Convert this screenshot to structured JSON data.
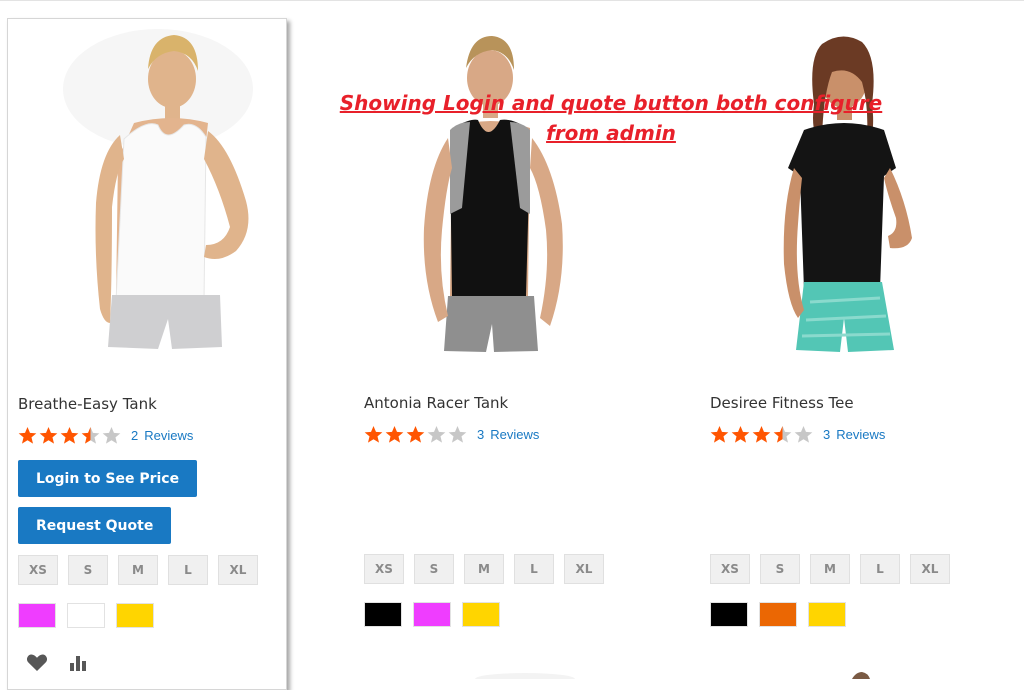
{
  "annotation": {
    "line1": "Showing Login and quote button both configure",
    "line2": "from admin"
  },
  "products": [
    {
      "name": "Breathe-Easy Tank",
      "rating_stars": 3.5,
      "review_count": "2",
      "review_label": "Reviews",
      "login_button": "Login to See Price",
      "quote_button": "Request Quote",
      "sizes": [
        "XS",
        "S",
        "M",
        "L",
        "XL"
      ],
      "colors": [
        "#ef3dff",
        "#ffffff",
        "#ffd500"
      ]
    },
    {
      "name": "Antonia Racer Tank",
      "rating_stars": 3,
      "review_count": "3",
      "review_label": "Reviews",
      "sizes": [
        "XS",
        "S",
        "M",
        "L",
        "XL"
      ],
      "colors": [
        "#000000",
        "#ef3dff",
        "#ffd500"
      ]
    },
    {
      "name": "Desiree Fitness Tee",
      "rating_stars": 3.5,
      "review_count": "3",
      "review_label": "Reviews",
      "sizes": [
        "XS",
        "S",
        "M",
        "L",
        "XL"
      ],
      "colors": [
        "#000000",
        "#eb6703",
        "#ffd500"
      ]
    }
  ],
  "icons": {
    "wishlist": "heart-icon",
    "compare": "compare-icon"
  },
  "theme": {
    "accent": "#1979c3",
    "star_filled": "#ff5501",
    "star_empty": "#c7c7c7",
    "annotation_color": "#e8202a"
  }
}
